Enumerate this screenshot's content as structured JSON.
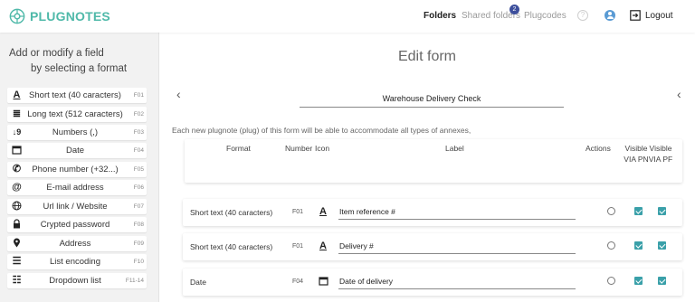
{
  "header": {
    "logo_text": "PLUGNOTES",
    "nav": {
      "folders": "Folders",
      "shared_folders": "Shared folders",
      "shared_badge": "2",
      "plugcodes": "Plugcodes",
      "help": "?",
      "logout": "Logout"
    }
  },
  "sidebar": {
    "title_line1": "Add or modify a field",
    "title_line2": "by selecting a format",
    "formats": [
      {
        "icon": "text-a-icon",
        "label": "Short text (40 caracters)",
        "code": "F01"
      },
      {
        "icon": "paragraph-lines-icon",
        "label": "Long text (512 caracters)",
        "code": "F02"
      },
      {
        "icon": "sort-numeric-icon",
        "label": "Numbers (,)",
        "code": "F03"
      },
      {
        "icon": "calendar-icon",
        "label": "Date",
        "code": "F04"
      },
      {
        "icon": "phone-icon",
        "label": "Phone number (+32...)",
        "code": "F05"
      },
      {
        "icon": "at-sign-icon",
        "label": "E-mail address",
        "code": "F06"
      },
      {
        "icon": "globe-icon",
        "label": "Url link / Website",
        "code": "F07"
      },
      {
        "icon": "lock-icon",
        "label": "Crypted password",
        "code": "F08"
      },
      {
        "icon": "map-pin-icon",
        "label": "Address",
        "code": "F09"
      },
      {
        "icon": "list-icon",
        "label": "List encoding",
        "code": "F10"
      },
      {
        "icon": "dropdown-list-icon",
        "label": "Dropdown list",
        "code": "F11-14"
      }
    ]
  },
  "main": {
    "title": "Edit form",
    "form_name": "Warehouse Delivery Check",
    "info_text": "Each new plugnote (plug) of this form will be able to accommodate all types of annexes,",
    "columns": {
      "format": "Format",
      "number": "Number",
      "icon": "Icon",
      "label": "Label",
      "actions": "Actions",
      "visible_pn": "Visible VIA PN",
      "visible_pf": "Visible VIA PF"
    },
    "fields": [
      {
        "format": "Short text (40 caracters)",
        "code": "F01",
        "icon": "text-a-icon",
        "label": "Item reference #",
        "visible_pn": true,
        "visible_pf": true
      },
      {
        "format": "Short text (40 caracters)",
        "code": "F01",
        "icon": "text-a-icon",
        "label": "Delivery #",
        "visible_pn": true,
        "visible_pf": true
      },
      {
        "format": "Date",
        "code": "F04",
        "icon": "calendar-icon",
        "label": "Date of delivery",
        "visible_pn": true,
        "visible_pf": true
      }
    ]
  },
  "colors": {
    "brand": "#4fb9a9",
    "checkbox": "#3aa0a9",
    "badge": "#3d4f9c"
  }
}
